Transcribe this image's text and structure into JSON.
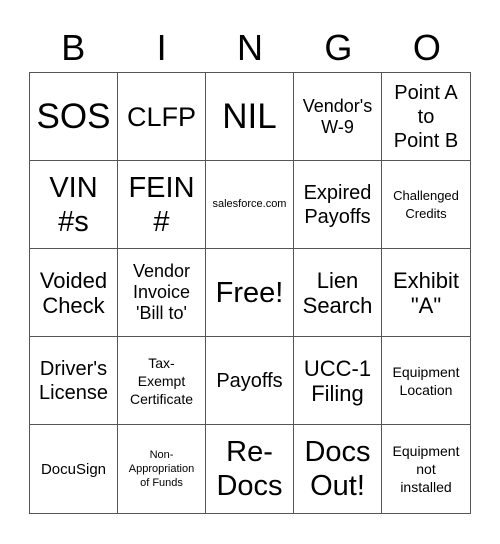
{
  "header": {
    "letters": [
      "B",
      "I",
      "N",
      "G",
      "O"
    ]
  },
  "board": {
    "cells": [
      "SOS",
      "CLFP",
      "NIL",
      "Vendor's\nW-9",
      "Point A\nto\nPoint B",
      "VIN\n#s",
      "FEIN\n#",
      "salesforce.com",
      "Expired\nPayoffs",
      "Challenged\nCredits",
      "Voided\nCheck",
      "Vendor\nInvoice\n'Bill to'",
      "Free!",
      "Lien\nSearch",
      "Exhibit\n\"A\"",
      "Driver's\nLicense",
      "Tax-\nExempt\nCertificate",
      "Payoffs",
      "UCC-1\nFiling",
      "Equipment\nLocation",
      "DocuSign",
      "Non-\nAppropriation\nof Funds",
      "Re-\nDocs",
      "Docs\nOut!",
      "Equipment\nnot\ninstalled"
    ],
    "free_space": "Free!"
  }
}
